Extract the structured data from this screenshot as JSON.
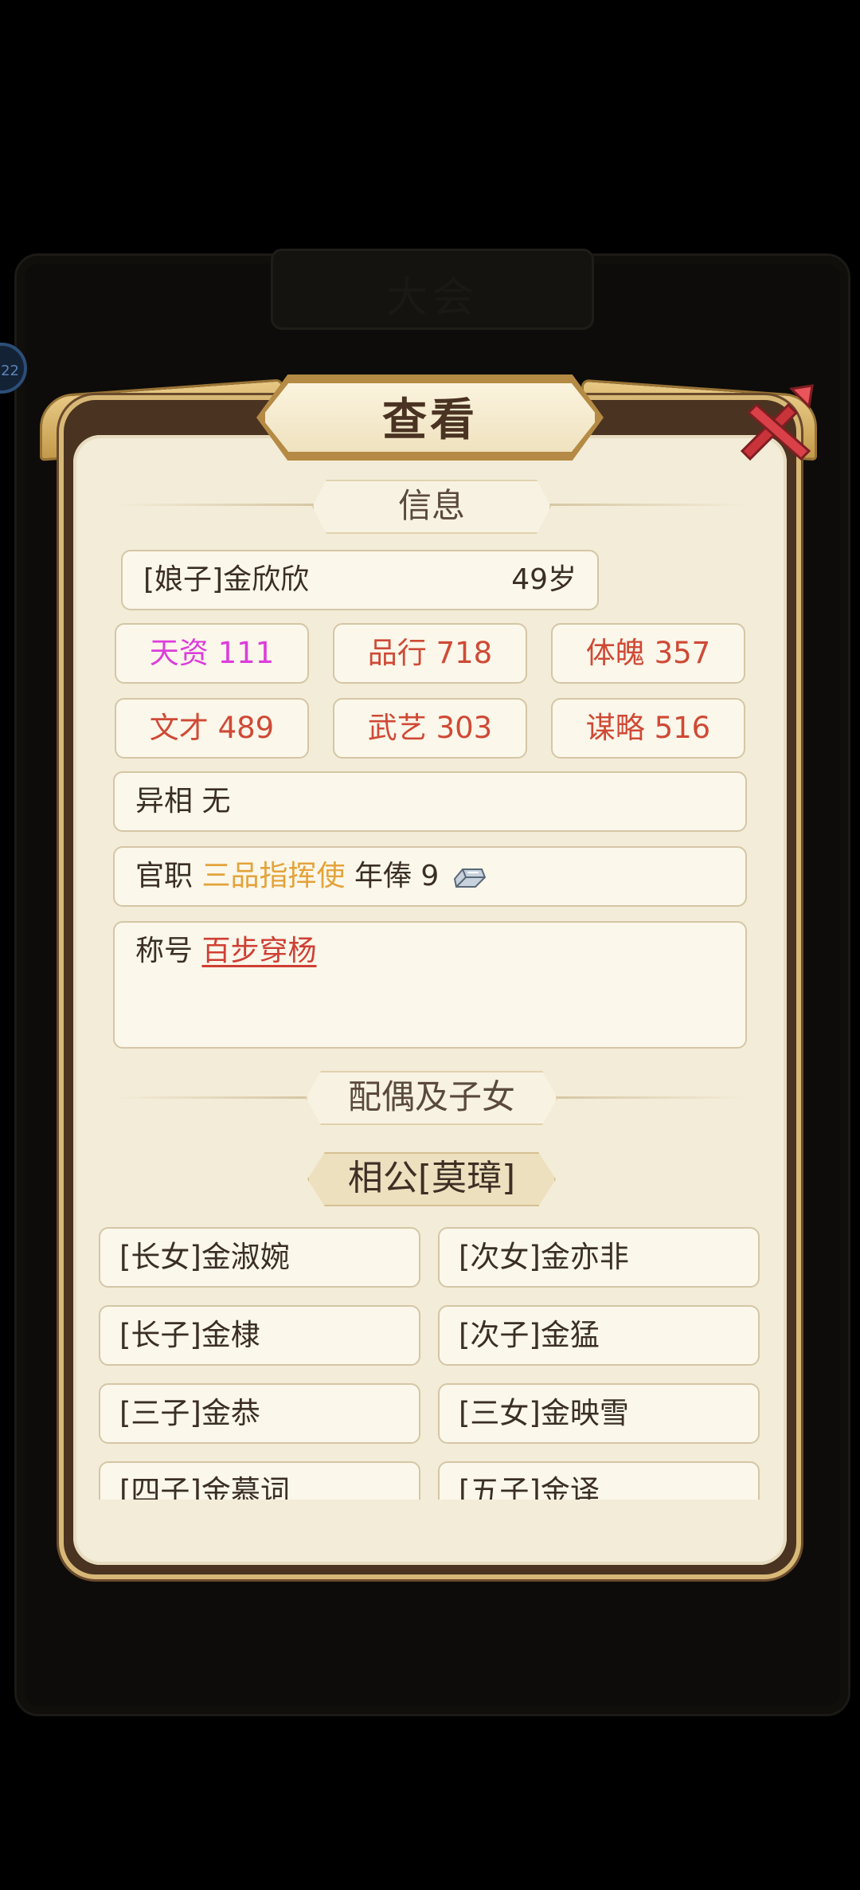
{
  "background": {
    "title": "大会",
    "badge": "22"
  },
  "dialog": {
    "title": "查看",
    "close_icon": "close-x-icon"
  },
  "info_section": {
    "header": "信息",
    "name": "[娘子]金欣欣",
    "age": "49岁",
    "stats": [
      {
        "label": "天资",
        "value": "111",
        "color": "#dd3ddb"
      },
      {
        "label": "品行",
        "value": "718",
        "color": "#cf4a36"
      },
      {
        "label": "体魄",
        "value": "357",
        "color": "#cf4a36"
      },
      {
        "label": "文才",
        "value": "489",
        "color": "#cf4a36"
      },
      {
        "label": "武艺",
        "value": "303",
        "color": "#cf4a36"
      },
      {
        "label": "谋略",
        "value": "516",
        "color": "#cf4a36"
      }
    ],
    "appearance_label": "异相",
    "appearance_value": "无",
    "office_label": "官职",
    "office_value": "三品指挥使",
    "salary_label": "年俸",
    "salary_value": "9",
    "salary_icon": "silver-ingot-icon",
    "title_label": "称号",
    "title_value": "百步穿杨"
  },
  "family_section": {
    "header": "配偶及子女",
    "spouse": "相公[莫璋]",
    "children": [
      "[长女]金淑婉",
      "[次女]金亦非",
      "[长子]金棣",
      "[次子]金猛",
      "[三子]金恭",
      "[三女]金映雪",
      "[四子]金慕词",
      "[五子]金译"
    ]
  }
}
